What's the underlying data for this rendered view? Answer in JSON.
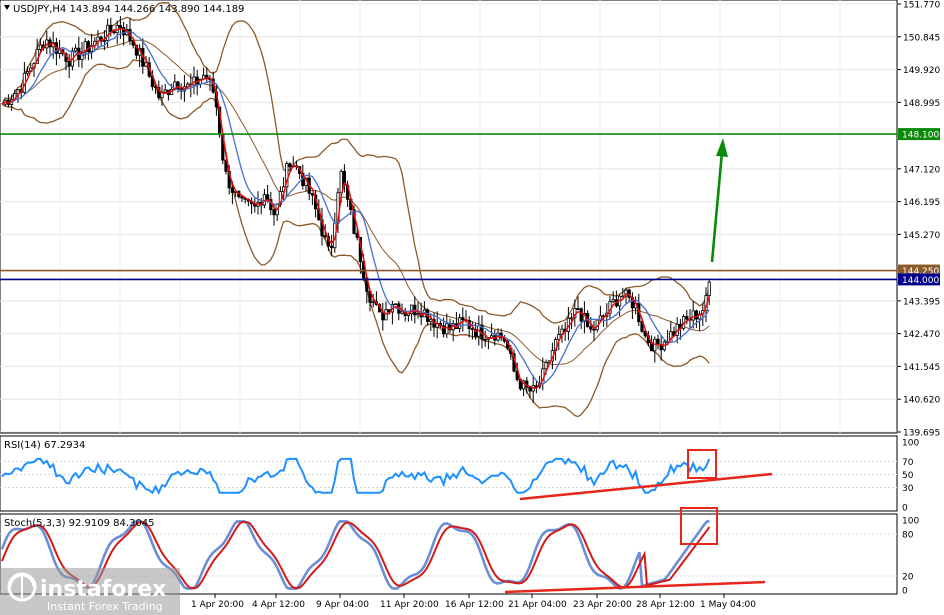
{
  "main_panel": {
    "title": "USDJPY,H4  143.894 144.266 143.890 144.189",
    "price_ticks": [
      "151.770",
      "150.845",
      "149.920",
      "148.995",
      "148.100",
      "147.120",
      "146.195",
      "145.270",
      "144.250",
      "144.000",
      "143.395",
      "142.470",
      "141.545",
      "140.620",
      "139.695"
    ],
    "price_min": 139.695,
    "price_max": 151.77,
    "levels": [
      {
        "label": "148.100",
        "value": 148.1,
        "color": "#0a8a0a"
      },
      {
        "label": "144.250",
        "value": 144.25,
        "color": "#8b5a2b"
      },
      {
        "label": "144.000",
        "value": 144.0,
        "color": "#00008b"
      }
    ],
    "arrow_color": "#0a8a0a"
  },
  "rsi_panel": {
    "title": "RSI(14) 67.2934",
    "ticks": [
      "100",
      "70",
      "50",
      "30",
      "0"
    ],
    "line_color": "#1e90ff",
    "trend_color": "#e8261b"
  },
  "stoch_panel": {
    "title": "Stoch(5,3,3) 92.9109 84.3045",
    "ticks": [
      "100",
      "80",
      "20",
      "0"
    ],
    "main_color": "#6c8ed6",
    "signal_color": "#d11a1a"
  },
  "time_axis": {
    "labels": [
      "1 Apr 20:00",
      "4 Apr 12:00",
      "9 Apr 04:00",
      "11 Apr 20:00",
      "16 Apr 12:00",
      "21 Apr 04:00",
      "23 Apr 20:00",
      "28 Apr 12:00",
      "1 May 04:00"
    ]
  },
  "branding": {
    "name": "instaforex",
    "tagline": "Instant Forex Trading"
  },
  "chart_data": {
    "type": "line",
    "title": "USDJPY,H4  143.894 144.266 143.890 144.189",
    "x": [
      "1 Apr 20:00",
      "4 Apr 12:00",
      "9 Apr 04:00",
      "11 Apr 20:00",
      "16 Apr 12:00",
      "21 Apr 04:00",
      "23 Apr 20:00",
      "28 Apr 12:00",
      "1 May 04:00"
    ],
    "series": [
      {
        "name": "USDJPY",
        "values": [
          149.5,
          146.2,
          146.7,
          143.3,
          142.5,
          140.9,
          143.6,
          142.3,
          144.19
        ]
      }
    ],
    "ylim": [
      139.695,
      151.77
    ],
    "grid": true
  }
}
